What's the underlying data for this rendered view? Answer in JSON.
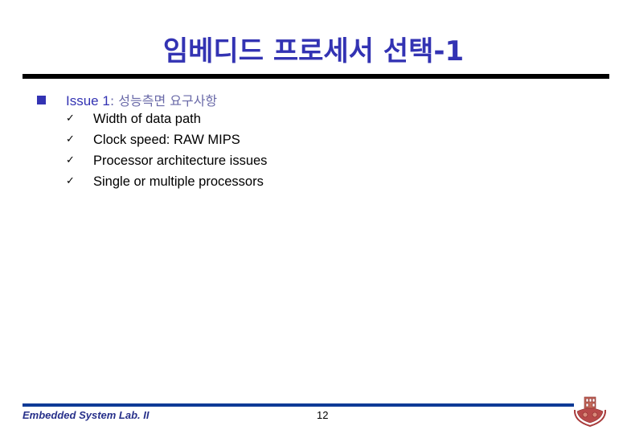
{
  "slide": {
    "title": "임베디드 프로세서 선택-1",
    "main_bullet": {
      "head": "Issue 1",
      "tail": ": 성능측면 요구사항"
    },
    "sub_bullets": [
      {
        "text": "Width of data path"
      },
      {
        "text": "Clock speed: RAW MIPS"
      },
      {
        "text": "Processor architecture issues"
      },
      {
        "text": "Single or multiple processors"
      }
    ],
    "check_glyph": "✓"
  },
  "footer": {
    "lab_name": "Embedded System Lab. II",
    "page_number": "12",
    "logo_icon": "university-emblem-icon"
  },
  "colors": {
    "title": "#3333b3",
    "footer_rule": "#0e3a96",
    "footer_text": "#27308a",
    "top_rule": "#000000"
  }
}
